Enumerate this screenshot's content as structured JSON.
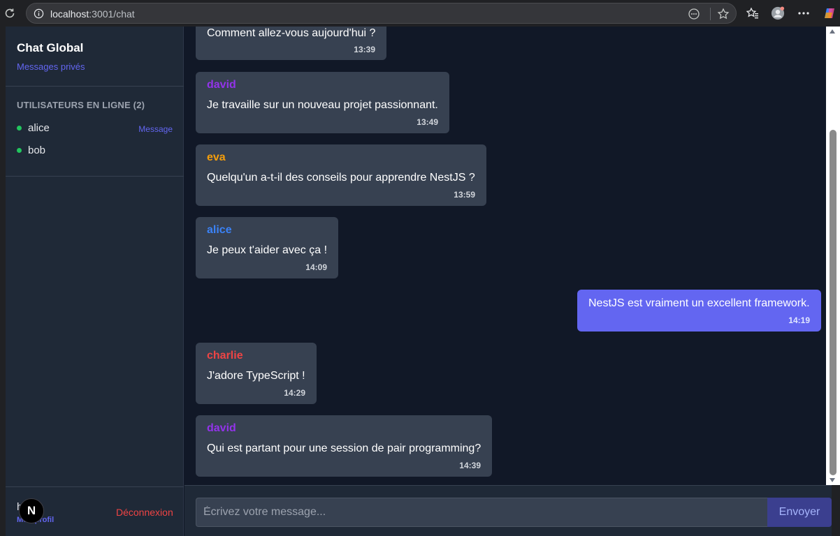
{
  "browser": {
    "url_host": "localhost",
    "url_path": ":3001/chat"
  },
  "sidebar": {
    "title": "Chat Global",
    "private_messages_link": "Messages privés",
    "users_heading": "UTILISATEURS EN LIGNE (2)",
    "users": [
      {
        "name": "alice",
        "action": "Message"
      },
      {
        "name": "bob",
        "action": ""
      }
    ],
    "footer": {
      "current_user_initial": "h",
      "profile_link": "Mon profil",
      "logout": "Déconnexion",
      "badge": "N"
    }
  },
  "messages": [
    {
      "author": "",
      "author_color": "",
      "text": "Comment allez-vous aujourd'hui ?",
      "time": "13:39",
      "own": false
    },
    {
      "author": "david",
      "author_color": "#9333ea",
      "text": "Je travaille sur un nouveau projet passionnant.",
      "time": "13:49",
      "own": false
    },
    {
      "author": "eva",
      "author_color": "#f59e0b",
      "text": "Quelqu'un a-t-il des conseils pour apprendre NestJS ?",
      "time": "13:59",
      "own": false
    },
    {
      "author": "alice",
      "author_color": "#3b82f6",
      "text": "Je peux t'aider avec ça !",
      "time": "14:09",
      "own": false
    },
    {
      "author": "",
      "author_color": "",
      "text": "NestJS est vraiment un excellent framework.",
      "time": "14:19",
      "own": true
    },
    {
      "author": "charlie",
      "author_color": "#ef4444",
      "text": "J'adore TypeScript !",
      "time": "14:29",
      "own": false
    },
    {
      "author": "david",
      "author_color": "#9333ea",
      "text": "Qui est partant pour une session de pair programming?",
      "time": "14:39",
      "own": false
    }
  ],
  "composer": {
    "placeholder": "Écrivez votre message...",
    "send_label": "Envoyer"
  },
  "colors": {
    "accent": "#6366f1",
    "online": "#22c55e",
    "danger": "#ef4444"
  }
}
